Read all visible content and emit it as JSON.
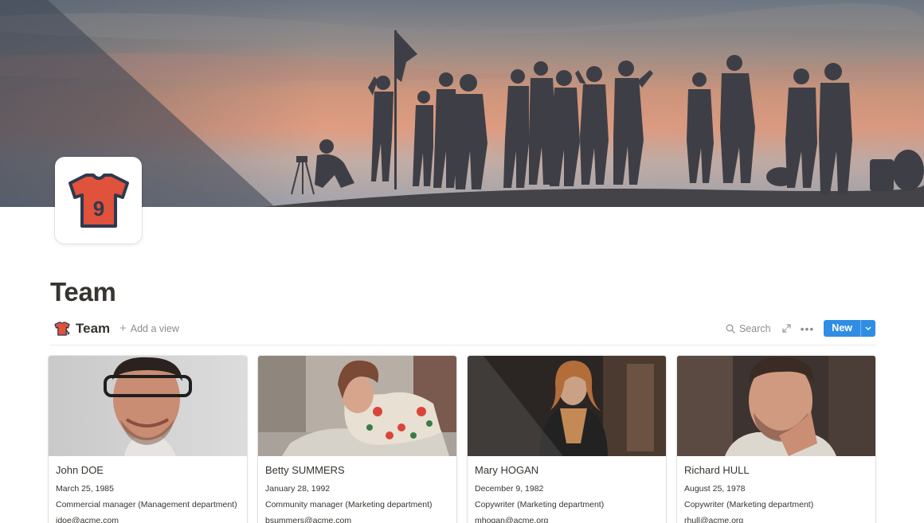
{
  "cover": {
    "description_icon": "group-silhouette-cover"
  },
  "page": {
    "icon": "jersey-9-icon",
    "title": "Team"
  },
  "database": {
    "icon": "jersey-9-icon",
    "title": "Team",
    "add_view_label": "Add a view",
    "search_label": "Search",
    "new_label": "New",
    "colors": {
      "new_button": "#2f8de4",
      "jersey": "#e0523b",
      "jersey_outline": "#2d3a4e"
    }
  },
  "cards": [
    {
      "name": "John DOE",
      "birthdate": "March 25, 1985",
      "role": "Commercial manager (Management department)",
      "email": "jdoe@acme.com"
    },
    {
      "name": "Betty SUMMERS",
      "birthdate": "January 28, 1992",
      "role": "Community manager (Marketing department)",
      "email": "bsummers@acme.com"
    },
    {
      "name": "Mary HOGAN",
      "birthdate": "December 9, 1982",
      "role": "Copywriter (Marketing department)",
      "email": "mhogan@acme.org"
    },
    {
      "name": "Richard HULL",
      "birthdate": "August 25, 1978",
      "role": "Copywriter (Marketing department)",
      "email": "rhull@acme.org"
    }
  ]
}
